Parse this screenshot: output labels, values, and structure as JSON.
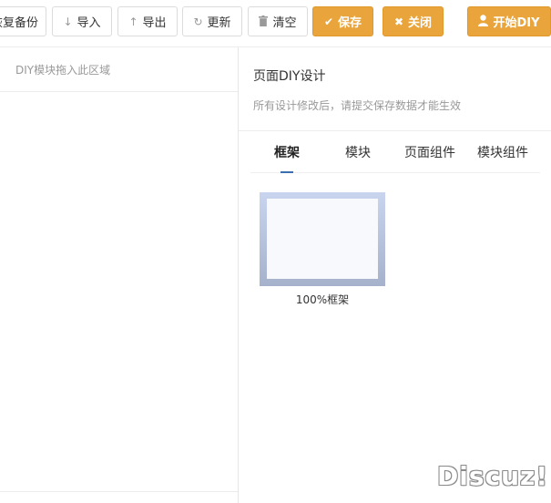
{
  "toolbar": {
    "restore_label": "恢复备份",
    "import_label": "导入",
    "export_label": "导出",
    "update_label": "更新",
    "clear_label": "清空",
    "save_label": "保存",
    "close_label": "关闭",
    "start_label": "开始DIY"
  },
  "icons": {
    "import": "↓",
    "export": "↑",
    "update": "↻",
    "clear": "trash",
    "save": "✔",
    "close": "✖",
    "start": "user"
  },
  "left_panel": {
    "drop_hint": "DIY模块拖入此区域"
  },
  "right_panel": {
    "title": "页面DIY设计",
    "note": "所有设计修改后，请提交保存数据才能生效",
    "tabs": [
      {
        "label": "框架",
        "active": true
      },
      {
        "label": "模块",
        "active": false
      },
      {
        "label": "页面组件",
        "active": false
      },
      {
        "label": "模块组件",
        "active": false
      }
    ],
    "frame_item": {
      "caption": "100%框架"
    }
  },
  "watermark": "Discuz!",
  "colors": {
    "accent": "#e9a53c",
    "tab_active": "#3a6fb0"
  }
}
